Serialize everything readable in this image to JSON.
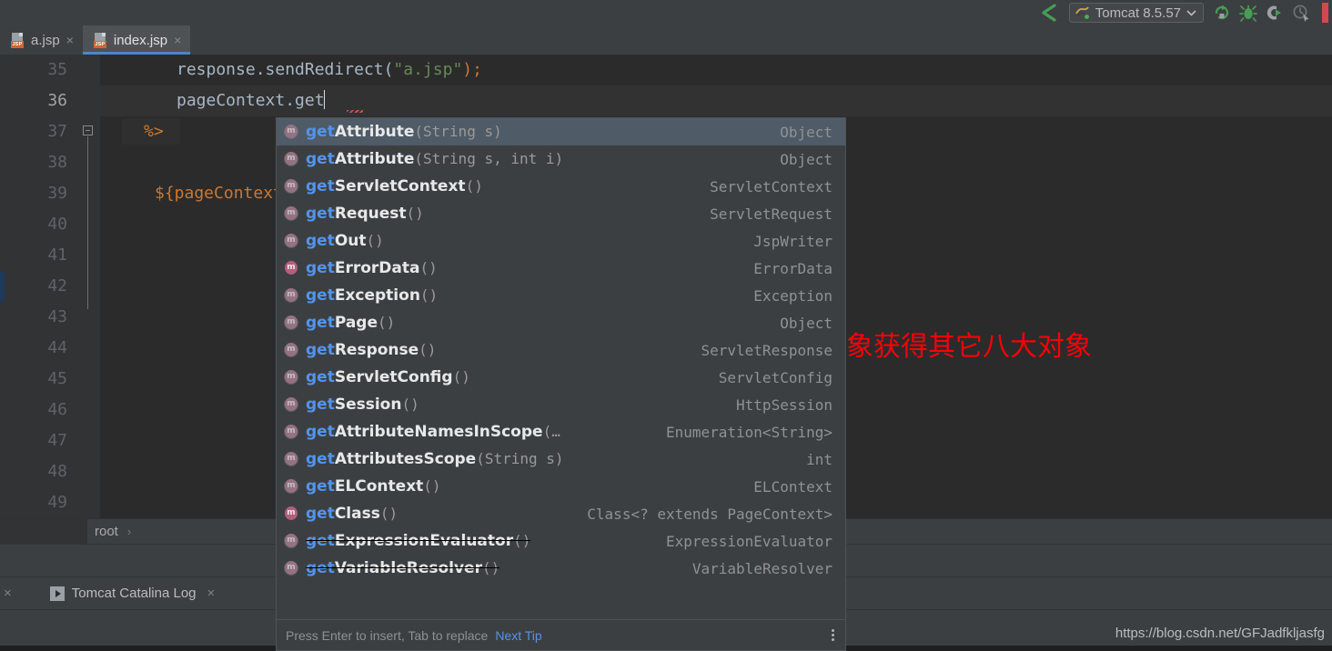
{
  "toolbar": {
    "run_config_label": "Tomcat 8.5.57",
    "icons": [
      {
        "name": "rerun-icon"
      },
      {
        "name": "debug-icon"
      },
      {
        "name": "run-with-coverage-icon"
      },
      {
        "name": "profiler-icon"
      },
      {
        "name": "stop-icon"
      }
    ]
  },
  "tabs": [
    {
      "label": "a.jsp",
      "active": false,
      "icon": "jsp-file-icon",
      "badge": "JSP",
      "close": "×"
    },
    {
      "label": "index.jsp",
      "active": true,
      "icon": "jsp-file-icon",
      "badge": "JSP",
      "close": "×"
    }
  ],
  "editor": {
    "line_numbers": [
      "35",
      "36",
      "37",
      "38",
      "39",
      "40",
      "41",
      "42",
      "43",
      "44",
      "45",
      "46",
      "47",
      "48",
      "49"
    ],
    "current_line": "36",
    "code": {
      "line35_obj": "response.sendRedirect(",
      "line35_str": "\"a.jsp\"",
      "line35_end": ");",
      "line36": "pageContext.get",
      "line37": "%>",
      "line39": "${pageContext"
    }
  },
  "annotation": {
    "text": "特殊对象获得其它八大对象",
    "color": "#fb0007"
  },
  "breadcrumb": {
    "item": "root",
    "separator": "›"
  },
  "log_panel": {
    "close_left": "×",
    "tab_label": "Tomcat Catalina Log",
    "tab_close": "×",
    "play_icon": "run-icon"
  },
  "watermark": "https://blog.csdn.net/GFJadfkljasfg",
  "completion": {
    "prefix": "get",
    "footer_hint": "Press Enter to insert, Tab to replace",
    "next_tip": "Next Tip",
    "kebab": "more-options-icon",
    "items": [
      {
        "prefix": "get",
        "rest": "Attribute",
        "params": "(String s)",
        "type": "Object",
        "selected": true,
        "deprecated": false,
        "inherited": true
      },
      {
        "prefix": "get",
        "rest": "Attribute",
        "params": "(String s, int i)",
        "type": "Object",
        "selected": false,
        "deprecated": false,
        "inherited": true
      },
      {
        "prefix": "get",
        "rest": "ServletContext",
        "params": "()",
        "type": "ServletContext",
        "selected": false,
        "deprecated": false,
        "inherited": true
      },
      {
        "prefix": "get",
        "rest": "Request",
        "params": "()",
        "type": "ServletRequest",
        "selected": false,
        "deprecated": false,
        "inherited": true
      },
      {
        "prefix": "get",
        "rest": "Out",
        "params": "()",
        "type": "JspWriter",
        "selected": false,
        "deprecated": false,
        "inherited": true
      },
      {
        "prefix": "get",
        "rest": "ErrorData",
        "params": "()",
        "type": "ErrorData",
        "selected": false,
        "deprecated": false,
        "inherited": false
      },
      {
        "prefix": "get",
        "rest": "Exception",
        "params": "()",
        "type": "Exception",
        "selected": false,
        "deprecated": false,
        "inherited": true
      },
      {
        "prefix": "get",
        "rest": "Page",
        "params": "()",
        "type": "Object",
        "selected": false,
        "deprecated": false,
        "inherited": true
      },
      {
        "prefix": "get",
        "rest": "Response",
        "params": "()",
        "type": "ServletResponse",
        "selected": false,
        "deprecated": false,
        "inherited": true
      },
      {
        "prefix": "get",
        "rest": "ServletConfig",
        "params": "()",
        "type": "ServletConfig",
        "selected": false,
        "deprecated": false,
        "inherited": true
      },
      {
        "prefix": "get",
        "rest": "Session",
        "params": "()",
        "type": "HttpSession",
        "selected": false,
        "deprecated": false,
        "inherited": true
      },
      {
        "prefix": "get",
        "rest": "AttributeNamesInScope",
        "params": "(…",
        "type": "Enumeration<String>",
        "selected": false,
        "deprecated": false,
        "inherited": true
      },
      {
        "prefix": "get",
        "rest": "AttributesScope",
        "params": "(String s)",
        "type": "int",
        "selected": false,
        "deprecated": false,
        "inherited": true
      },
      {
        "prefix": "get",
        "rest": "ELContext",
        "params": "()",
        "type": "ELContext",
        "selected": false,
        "deprecated": false,
        "inherited": true
      },
      {
        "prefix": "get",
        "rest": "Class",
        "params": "()",
        "type": "Class<? extends PageContext>",
        "selected": false,
        "deprecated": false,
        "inherited": false
      },
      {
        "prefix": "get",
        "rest": "ExpressionEvaluator",
        "params": "()",
        "type": "ExpressionEvaluator",
        "selected": false,
        "deprecated": true,
        "inherited": true
      },
      {
        "prefix": "get",
        "rest": "VariableResolver",
        "params": "()",
        "type": "VariableResolver",
        "selected": false,
        "deprecated": true,
        "inherited": true
      }
    ]
  }
}
